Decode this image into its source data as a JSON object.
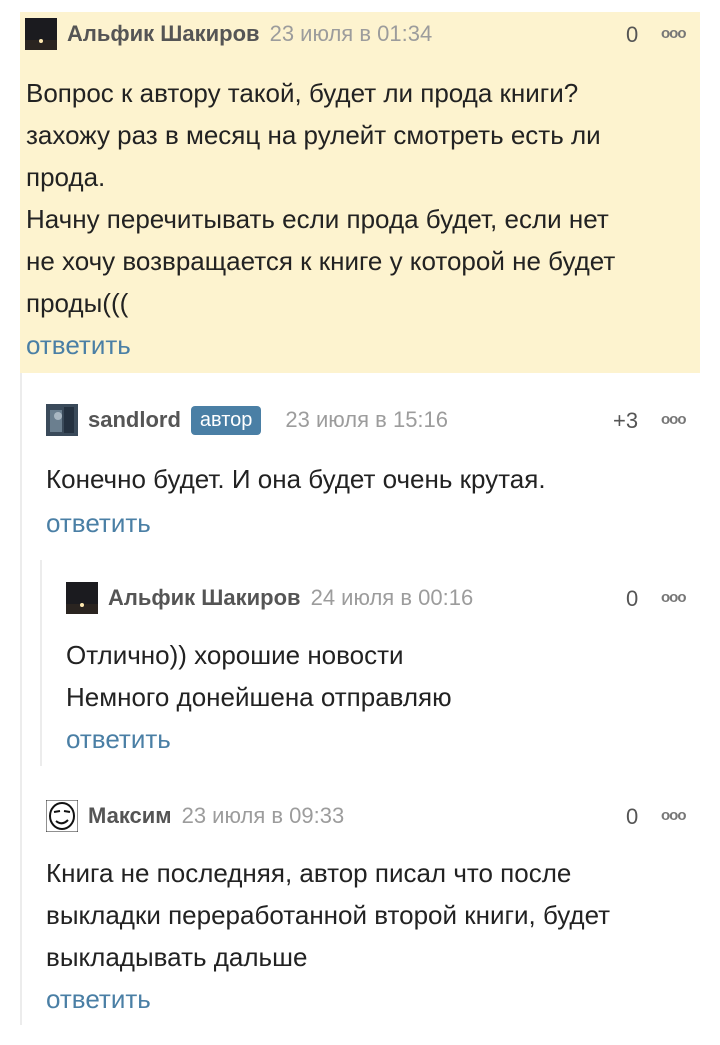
{
  "comments": [
    {
      "author": "Альфик Шакиров",
      "date": "23 июля в 01:34",
      "score": "0",
      "lines": [
        "Вопрос к автору такой, будет ли прода книги?",
        "захожу раз в месяц на рулейт смотреть есть ли",
        "прода.",
        "Начну перечитывать если прода будет, если нет",
        "не хочу возвращается к книге у которой не будет",
        "проды((("
      ],
      "reply": "ответить"
    },
    {
      "author": "sandlord",
      "badge": "автор",
      "date": "23 июля в 15:16",
      "score": "+3",
      "lines": [
        "Конечно будет. И она будет очень крутая."
      ],
      "reply": "ответить"
    },
    {
      "author": "Альфик Шакиров",
      "date": "24 июля в 00:16",
      "score": "0",
      "lines": [
        "Отлично)) хорошие новости",
        "Немного донейшена отправляю"
      ],
      "reply": "ответить"
    },
    {
      "author": "Максим",
      "date": "23 июля в 09:33",
      "score": "0",
      "lines": [
        "Книга не последняя, автор писал что после",
        "выкладки переработанной второй книги, будет",
        "выкладывать дальше"
      ],
      "reply": "ответить"
    }
  ],
  "icons": {
    "more": "more-options-icon",
    "accent": "#4a7fa5",
    "highlight_bg": "#fdf3cf"
  }
}
